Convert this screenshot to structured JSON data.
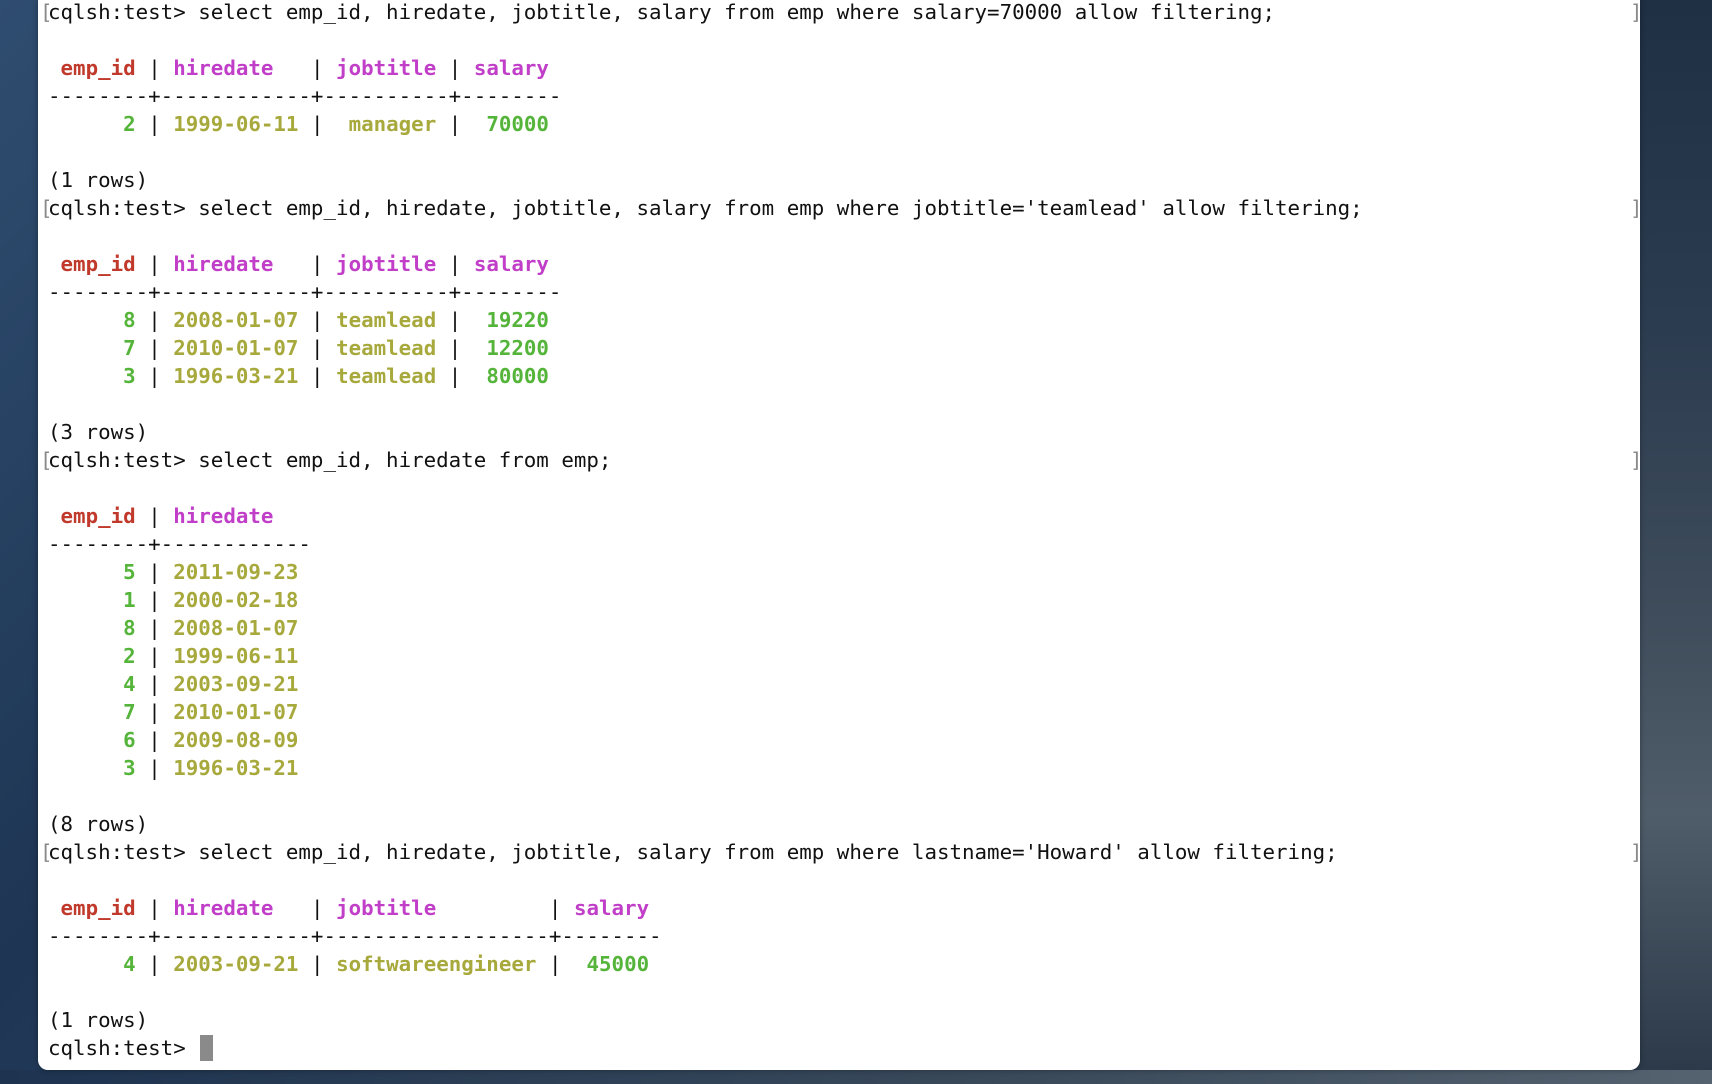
{
  "prompt": "cqlsh:test> ",
  "queries": [
    {
      "command": "select emp_id, hiredate, jobtitle, salary from emp where salary=70000 allow filtering;",
      "header": [
        "emp_id",
        "hiredate",
        "jobtitle",
        "salary"
      ],
      "separator": "--------+------------+----------+--------",
      "rows": [
        {
          "emp_id": "2",
          "hiredate": "1999-06-11",
          "jobtitle": "manager",
          "salary": "70000"
        }
      ],
      "footer": "(1 rows)"
    },
    {
      "command": "select emp_id, hiredate, jobtitle, salary from emp where jobtitle='teamlead' allow filtering;",
      "header": [
        "emp_id",
        "hiredate",
        "jobtitle",
        "salary"
      ],
      "separator": "--------+------------+----------+--------",
      "rows": [
        {
          "emp_id": "8",
          "hiredate": "2008-01-07",
          "jobtitle": "teamlead",
          "salary": "19220"
        },
        {
          "emp_id": "7",
          "hiredate": "2010-01-07",
          "jobtitle": "teamlead",
          "salary": "12200"
        },
        {
          "emp_id": "3",
          "hiredate": "1996-03-21",
          "jobtitle": "teamlead",
          "salary": "80000"
        }
      ],
      "footer": "(3 rows)"
    },
    {
      "command": "select emp_id, hiredate from emp;",
      "header": [
        "emp_id",
        "hiredate"
      ],
      "separator": "--------+------------",
      "rows": [
        {
          "emp_id": "5",
          "hiredate": "2011-09-23"
        },
        {
          "emp_id": "1",
          "hiredate": "2000-02-18"
        },
        {
          "emp_id": "8",
          "hiredate": "2008-01-07"
        },
        {
          "emp_id": "2",
          "hiredate": "1999-06-11"
        },
        {
          "emp_id": "4",
          "hiredate": "2003-09-21"
        },
        {
          "emp_id": "7",
          "hiredate": "2010-01-07"
        },
        {
          "emp_id": "6",
          "hiredate": "2009-08-09"
        },
        {
          "emp_id": "3",
          "hiredate": "1996-03-21"
        }
      ],
      "footer": "(8 rows)"
    },
    {
      "command": "select emp_id, hiredate, jobtitle, salary from emp where lastname='Howard' allow filtering;",
      "header": [
        "emp_id",
        "hiredate",
        "jobtitle",
        "salary"
      ],
      "separator": "--------+------------+------------------+--------",
      "rows": [
        {
          "emp_id": "4",
          "hiredate": "2003-09-21",
          "jobtitle": "softwareengineer",
          "salary": "45000"
        }
      ],
      "footer": "(1 rows)"
    }
  ],
  "colors": {
    "header_id": "#c0392b",
    "header_other": "#c13fc8",
    "value_green": "#55b43a",
    "value_yellow": "#a7a93c"
  }
}
